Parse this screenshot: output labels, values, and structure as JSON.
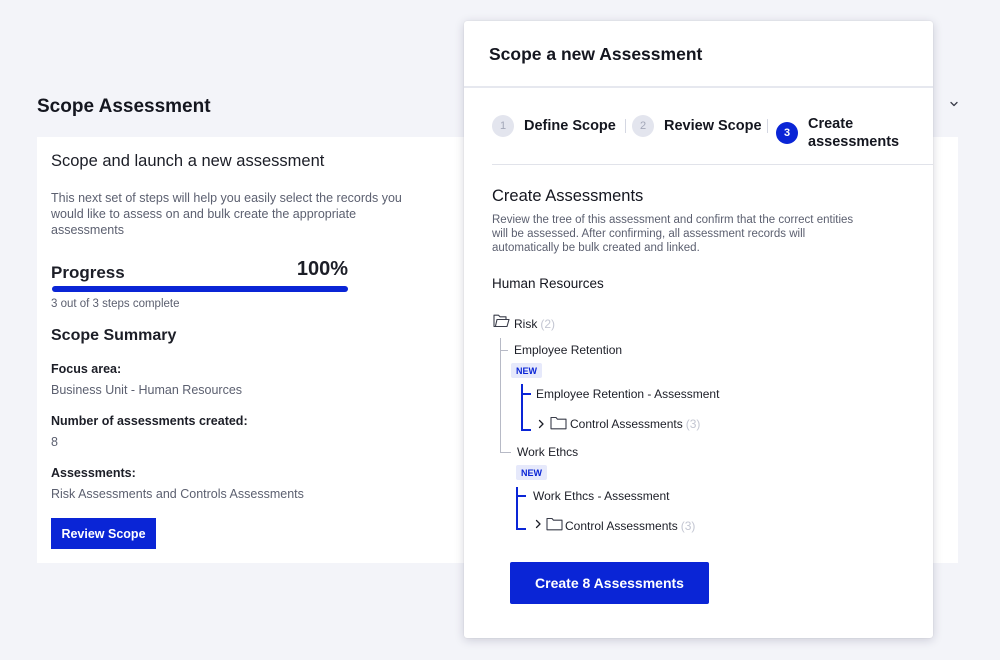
{
  "page": {
    "title": "Scope Assessment"
  },
  "card": {
    "heading": "Scope and launch a new assessment",
    "description": "This next set of steps will help you easily select the records you would like to assess on and bulk create the appropriate assessments",
    "progress": {
      "label": "Progress",
      "percent_text": "100%",
      "fraction": 1.0,
      "subtext": "3 out of 3 steps complete"
    },
    "summary": {
      "title": "Scope Summary",
      "focus_label": "Focus area:",
      "focus_value": "Business Unit - Human Resources",
      "count_label": "Number of assessments created:",
      "count_value": "8",
      "assessments_label": "Assessments:",
      "assessments_value": "Risk Assessments and Controls Assessments"
    },
    "review_button": "Review Scope"
  },
  "modal": {
    "title": "Scope a new Assessment",
    "steps": [
      {
        "number": "1",
        "label": "Define Scope",
        "state": "done"
      },
      {
        "number": "2",
        "label": "Review Scope",
        "state": "done"
      },
      {
        "number": "3",
        "label": "Create assessments",
        "state": "active"
      }
    ],
    "section_title": "Create Assessments",
    "section_description": "Review the tree of this assessment and confirm that the correct entities will be assessed. After confirming, all assessment records will automatically be bulk created and linked.",
    "group_title": "Human Resources",
    "tree": {
      "root_label": "Risk",
      "root_count": "(2)",
      "children": [
        {
          "label": "Employee Retention",
          "badge": "NEW",
          "assessment": "Employee Retention - Assessment",
          "controls_label": "Control Assessments",
          "controls_count": "(3)"
        },
        {
          "label": "Work Ethcs",
          "badge": "NEW",
          "assessment": "Work Ethcs - Assessment",
          "controls_label": "Control Assessments",
          "controls_count": "(3)"
        }
      ]
    },
    "create_button": "Create 8 Assessments"
  },
  "colors": {
    "accent": "#0a25d6",
    "background": "#f3f4f9",
    "muted_text": "#5c6070"
  },
  "icons": {
    "collapse": "chevron-down-icon",
    "folder": "folder-icon",
    "expand": "chevron-right-icon"
  }
}
